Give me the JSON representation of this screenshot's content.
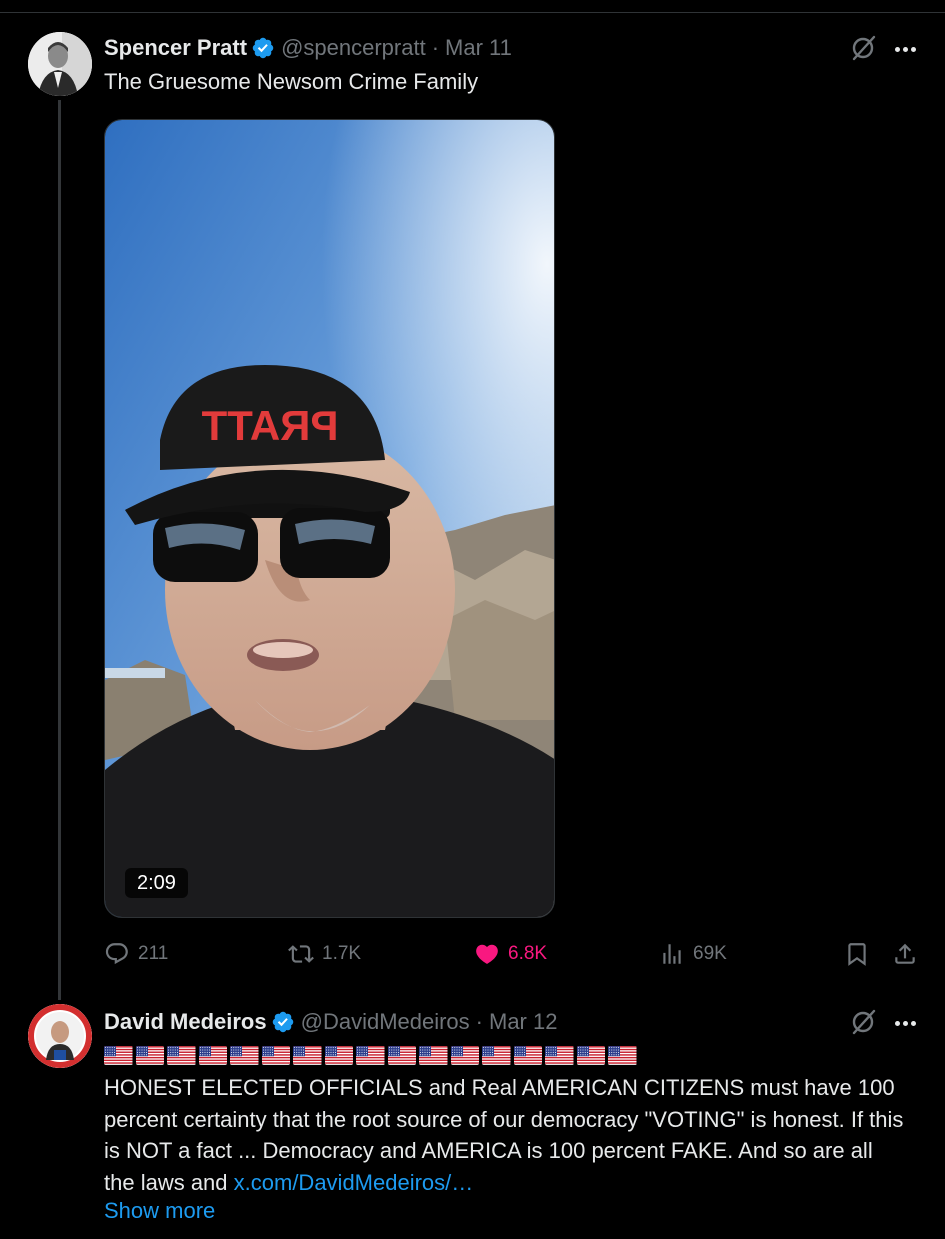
{
  "colors": {
    "background": "#000000",
    "text_primary": "#e7e9ea",
    "text_secondary": "#71767b",
    "accent_blue": "#1d9bf0",
    "like_pink": "#f91880"
  },
  "tweet1": {
    "display_name": "Spencer Pratt",
    "handle": "@spencerpratt",
    "separator": "·",
    "date": "Mar 11",
    "text": "The Gruesome Newsom Crime Family",
    "media": {
      "cap_text": "PRATT",
      "duration": "2:09"
    },
    "icons": {
      "verified": "verified-badge-icon",
      "grok": "grok-icon",
      "more": "more-icon"
    },
    "actions": {
      "replies": "211",
      "reposts": "1.7K",
      "likes": "6.8K",
      "liked": true,
      "views": "69K"
    }
  },
  "tweet2": {
    "display_name": "David Medeiros",
    "handle": "@DavidMedeiros",
    "separator": "·",
    "date": "Mar 12",
    "flag_emoji": "🇺🇸",
    "flag_count": 17,
    "text": "HONEST ELECTED OFFICIALS and Real AMERICAN CITIZENS must have 100 percent certainty that the root source of our democracy \"VOTING\" is honest.  If this is NOT a fact ...  Democracy and AMERICA is 100 percent FAKE.  And so are all the laws and ",
    "link": "x.com/DavidMedeiros/…",
    "show_more": "Show more"
  }
}
